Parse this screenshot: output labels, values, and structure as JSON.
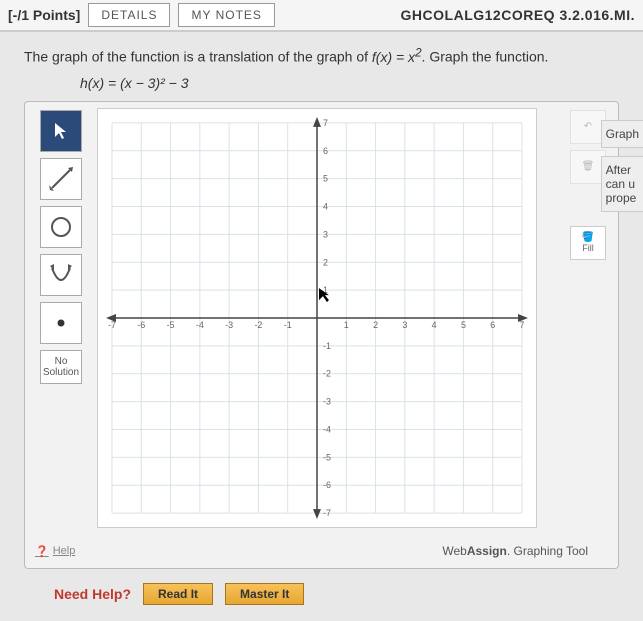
{
  "header": {
    "points": "[-/1 Points]",
    "details": "DETAILS",
    "mynotes": "MY NOTES",
    "qref": "GHCOLALG12COREQ 3.2.016.MI."
  },
  "prompt": {
    "text1": "The graph of the function is a translation of the graph of ",
    "fx": "f(x) = x",
    "fx_sup": "2",
    "text2": ". Graph the function."
  },
  "equation": "h(x) = (x − 3)² − 3",
  "tools": {
    "pointer": "↖",
    "line_icon": "line-icon",
    "circle_icon": "circle-icon",
    "parabola_icon": "parabola-icon",
    "point_icon": "point-icon",
    "nosolution": "No Solution"
  },
  "right_tools": {
    "undo": "↶",
    "trash": "🗑",
    "fill_label": "Fill",
    "fill_icon": "🪣"
  },
  "help_link": "Help",
  "brand": {
    "part1": "Web",
    "part2": "Assign",
    "suffix": ". Graphing Tool"
  },
  "side": {
    "tab1": "Graph",
    "tab2a": "After",
    "tab2b": "can u",
    "tab2c": "prope"
  },
  "need_help": {
    "label": "Need Help?",
    "read": "Read It",
    "master": "Master It"
  },
  "chart_data": {
    "type": "scatter",
    "series": [],
    "title": "",
    "xlabel": "",
    "ylabel": "",
    "xlim": [
      -7,
      7
    ],
    "ylim": [
      -7,
      7
    ],
    "xticks": [
      -7,
      -6,
      -5,
      -4,
      -3,
      -2,
      -1,
      1,
      2,
      3,
      4,
      5,
      6,
      7
    ],
    "yticks": [
      -7,
      -6,
      -5,
      -4,
      -3,
      -2,
      -1,
      1,
      2,
      3,
      4,
      5,
      6,
      7
    ],
    "grid": true
  }
}
